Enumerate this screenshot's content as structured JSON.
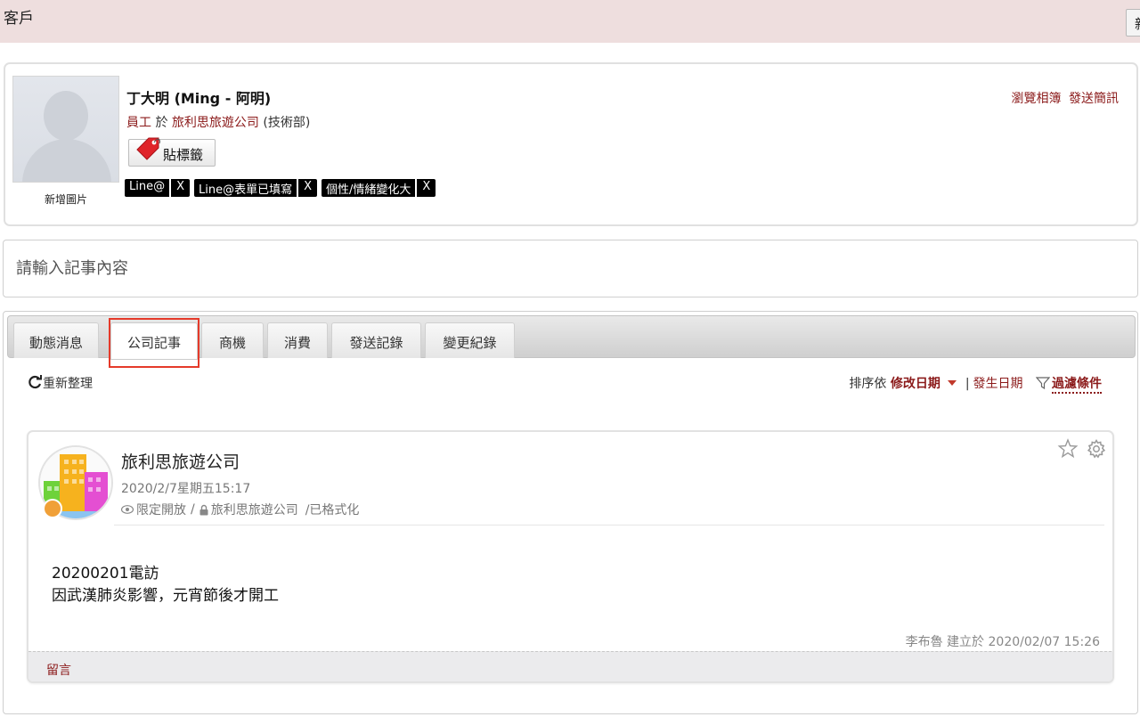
{
  "topbar": {
    "title": "客戶",
    "new_button_label": "新增"
  },
  "profile": {
    "avatar_caption": "新增圖片",
    "name": "丁大明 (Ming - 阿明)",
    "role": "員工",
    "role_sep": " 於 ",
    "company": "旅利思旅遊公司",
    "department": " (技術部)",
    "tag_button_label": "貼標籤",
    "tags": [
      "Line@",
      "Line@表單已填寫",
      "個性/情緒變化大"
    ],
    "tag_remove_label": "X",
    "links": [
      "瀏覽相簿",
      "發送簡訊"
    ]
  },
  "note_input": {
    "placeholder": "請輸入記事內容"
  },
  "tabs": [
    {
      "label": "動態消息",
      "active": false
    },
    {
      "label": "公司記事",
      "active": true
    },
    {
      "label": "商機",
      "active": false
    },
    {
      "label": "消費",
      "active": false
    },
    {
      "label": "發送記錄",
      "active": false
    },
    {
      "label": "變更紀錄",
      "active": false
    }
  ],
  "toolbar": {
    "refresh_label": "重新整理",
    "sort_prefix": "排序依",
    "sort_active": "修改日期",
    "sort_separator": "|",
    "sort_alt": "發生日期",
    "filter_label": "過濾條件"
  },
  "note_card": {
    "company": "旅利思旅遊公司",
    "datetime": "2020/2/7星期五15:17",
    "visibility": "限定開放",
    "owner": "旅利思旅遊公司",
    "format": "/已格式化",
    "body_line1": "20200201電訪",
    "body_line2": "因武漢肺炎影響，元宵節後才開工",
    "creator": "李布魯  建立於 2020/02/07 15:26",
    "comment_label": "留言"
  },
  "colors": {
    "topbar_bg": "#eedede",
    "link": "#8b1a1a",
    "highlight_box": "#e53a2a",
    "tag_chip": "#000000"
  }
}
